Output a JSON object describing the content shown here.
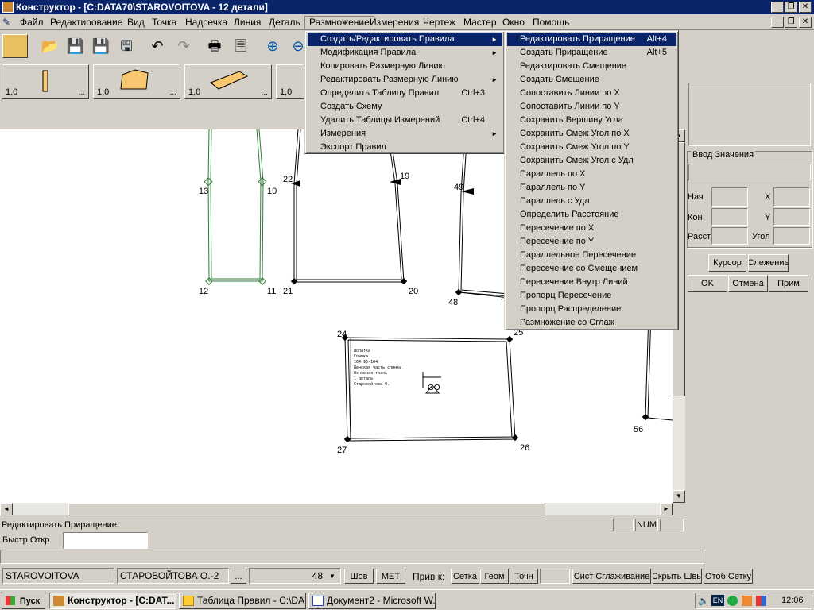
{
  "window": {
    "title": "Конструктор - [C:DATA70\\STAROVOITOVA  - 12 детали]",
    "min": "_",
    "restore": "❐",
    "close": "✕"
  },
  "menubar": [
    "Файл",
    "Редактирование",
    "Вид",
    "Точка",
    "Надсечка",
    "Линия",
    "Деталь",
    "Размножение",
    "Измерения",
    "Чертеж",
    "Мастер",
    "Окно",
    "Помощь"
  ],
  "menu1": {
    "items": [
      {
        "label": "Создать/Редактировать Правила",
        "acc": "",
        "arrow": "►"
      },
      {
        "label": "Модификация Правила",
        "acc": "",
        "arrow": "►"
      },
      {
        "label": "Копировать Размерную Линию",
        "acc": "",
        "arrow": ""
      },
      {
        "label": "Редактировать Размерную Линию",
        "acc": "",
        "arrow": "►"
      },
      {
        "label": "Определить Таблицу Правил",
        "acc": "Ctrl+3",
        "arrow": ""
      },
      {
        "label": "Создать Схему",
        "acc": "",
        "arrow": ""
      },
      {
        "label": "Удалить Таблицы Измерений",
        "acc": "Ctrl+4",
        "arrow": ""
      },
      {
        "label": "Измерения",
        "acc": "",
        "arrow": "►"
      },
      {
        "label": "Экспорт Правил",
        "acc": "",
        "arrow": ""
      }
    ]
  },
  "menu2": {
    "items": [
      {
        "label": "Редактировать Приращение",
        "acc": "Alt+4"
      },
      {
        "label": "Создать Приращение",
        "acc": "Alt+5"
      },
      {
        "label": "Редактировать Смещение",
        "acc": ""
      },
      {
        "label": "Создать Смещение",
        "acc": ""
      },
      {
        "label": "Сопоставить Линии по X",
        "acc": ""
      },
      {
        "label": "Сопоставить Линии по Y",
        "acc": ""
      },
      {
        "label": "Сохранить Вершину Угла",
        "acc": ""
      },
      {
        "label": "Сохранить Смеж Угол по X",
        "acc": ""
      },
      {
        "label": "Сохранить Смеж Угол по Y",
        "acc": ""
      },
      {
        "label": "Сохранить Смеж Угол с Удл",
        "acc": ""
      },
      {
        "label": "Параллель по X",
        "acc": ""
      },
      {
        "label": "Параллель по Y",
        "acc": ""
      },
      {
        "label": "Параллель с Удл",
        "acc": ""
      },
      {
        "label": "Определить Расстояние",
        "acc": ""
      },
      {
        "label": "Пересечение по X",
        "acc": ""
      },
      {
        "label": "Пересечение по Y",
        "acc": ""
      },
      {
        "label": "Параллельное Пересечение",
        "acc": ""
      },
      {
        "label": "Пересечение со Смещением",
        "acc": ""
      },
      {
        "label": "Пересечение Внутр Линий",
        "acc": ""
      },
      {
        "label": "Пропорц Пересечение",
        "acc": ""
      },
      {
        "label": "Пропорц Распределение",
        "acc": ""
      },
      {
        "label": "Размножение со Сглаж",
        "acc": ""
      }
    ]
  },
  "palette": [
    "1,0",
    "1,0",
    "1,0",
    "1,0"
  ],
  "palette_dots": "...",
  "drawing": {
    "points": [
      "13",
      "10",
      "12",
      "11",
      "22",
      "19",
      "21",
      "20",
      "49",
      "48",
      "24",
      "25",
      "27",
      "26",
      "56"
    ],
    "piece_note": [
      "Лопатка",
      "Спинка",
      "164-96-104",
      "Женская часть спинки",
      "Основная ткань",
      "1 деталь",
      "Старовойтова О."
    ],
    "grain": "GO"
  },
  "rightpanel": {
    "input_group": "Ввод Значения",
    "nach": "Нач",
    "x": "X",
    "kon": "Кон",
    "y": "Y",
    "rast": "Расст",
    "ugol": "Угол",
    "cursor_btn": "Курсор",
    "follow_btn": "Слежение",
    "ok_btn": "OK",
    "cancel_btn": "Отмена",
    "apply_btn": "Прим"
  },
  "status": {
    "hint": "Редактировать Приращение",
    "num": "NUM"
  },
  "quick": {
    "label": "Быстр Откр",
    "value": ""
  },
  "bottom": {
    "user": "STAROVOITOVA",
    "user_ru": "СТАРОВОЙТОВА О.-2",
    "ellipsis": "...",
    "size": "48",
    "shov": "Шов",
    "met": "МЕТ",
    "priv": "Прив к:",
    "setka": "Сетка",
    "geom": "Геом",
    "toch": "Точн",
    "sist": "Сист Сглаживание",
    "hide": "Скрыть Швы",
    "grid": "Отоб Сетку"
  },
  "taskbar": {
    "start": "Пуск",
    "tasks": [
      "Конструктор - [C:DAT...",
      "Таблица Правил - C:\\DA...",
      "Документ2 - Microsoft W..."
    ],
    "lang": "EN",
    "clock": "12:06"
  },
  "colors": {
    "title": "#0a246a",
    "menu_sel": "#0a246a",
    "piece_green": "#2e7d32"
  }
}
